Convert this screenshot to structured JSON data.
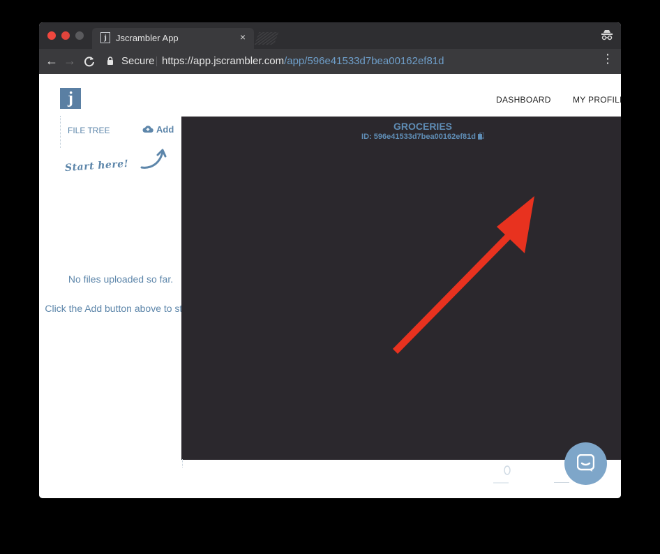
{
  "browser": {
    "tab_title": "Jscrambler App",
    "tab_close": "×",
    "back_icon": "←",
    "forward_icon": "→",
    "reload_icon": "C",
    "secure_label": "Secure",
    "url_host": "https://app.jscrambler.com",
    "url_path": "/app/596e41533d7bea00162ef81d",
    "star_icon": "☆",
    "menu_icon": "⋮"
  },
  "header": {
    "logo_letter": "j",
    "nav": {
      "dashboard": "DASHBOARD",
      "profile": "MY PROFILE"
    }
  },
  "sidebar": {
    "title": "FILE TREE",
    "add_label": "Add",
    "start_here": "Start here!",
    "empty_line1": "No files uploaded so far.",
    "empty_line2": "Click the Add button above to start."
  },
  "editor": {
    "project_title": "GROCERIES",
    "project_id": "ID: 596e41533d7bea00162ef81d"
  },
  "colors": {
    "accent": "#5d86aa",
    "editor_bg": "#2b282d",
    "annotation_arrow": "#e8321f"
  }
}
